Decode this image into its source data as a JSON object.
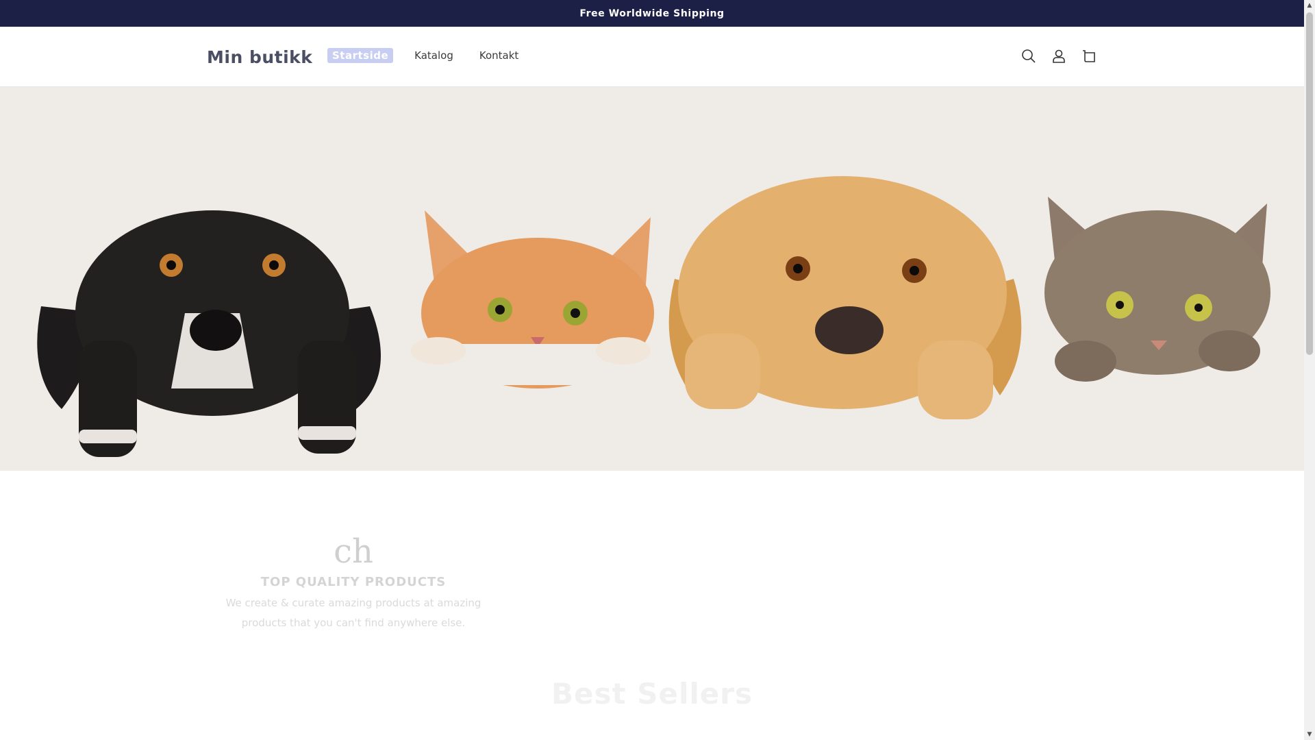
{
  "announcement": {
    "text": "Free Worldwide Shipping"
  },
  "header": {
    "logo": "Min butikk",
    "nav": [
      {
        "label": "Startside",
        "active": true
      },
      {
        "label": "Katalog",
        "active": false
      },
      {
        "label": "Kontakt",
        "active": false
      }
    ],
    "icons": [
      "search-icon",
      "account-icon",
      "cart-icon"
    ]
  },
  "hero": {
    "background_color": "#efebe6",
    "animals": [
      "black-and-white-dog",
      "orange-cat",
      "golden-retriever",
      "tabby-cat"
    ]
  },
  "feature": {
    "glyph": "ch",
    "title": "TOP QUALITY PRODUCTS",
    "text_line1": "We create & curate amazing products at amazing",
    "text_line2": "products that you can't find anywhere else."
  },
  "best_sellers": {
    "title": "Best Sellers"
  },
  "colors": {
    "announcement_bg": "#1c1f46",
    "active_nav_bg": "#c8cdf2",
    "logo": "#4b4f63"
  }
}
